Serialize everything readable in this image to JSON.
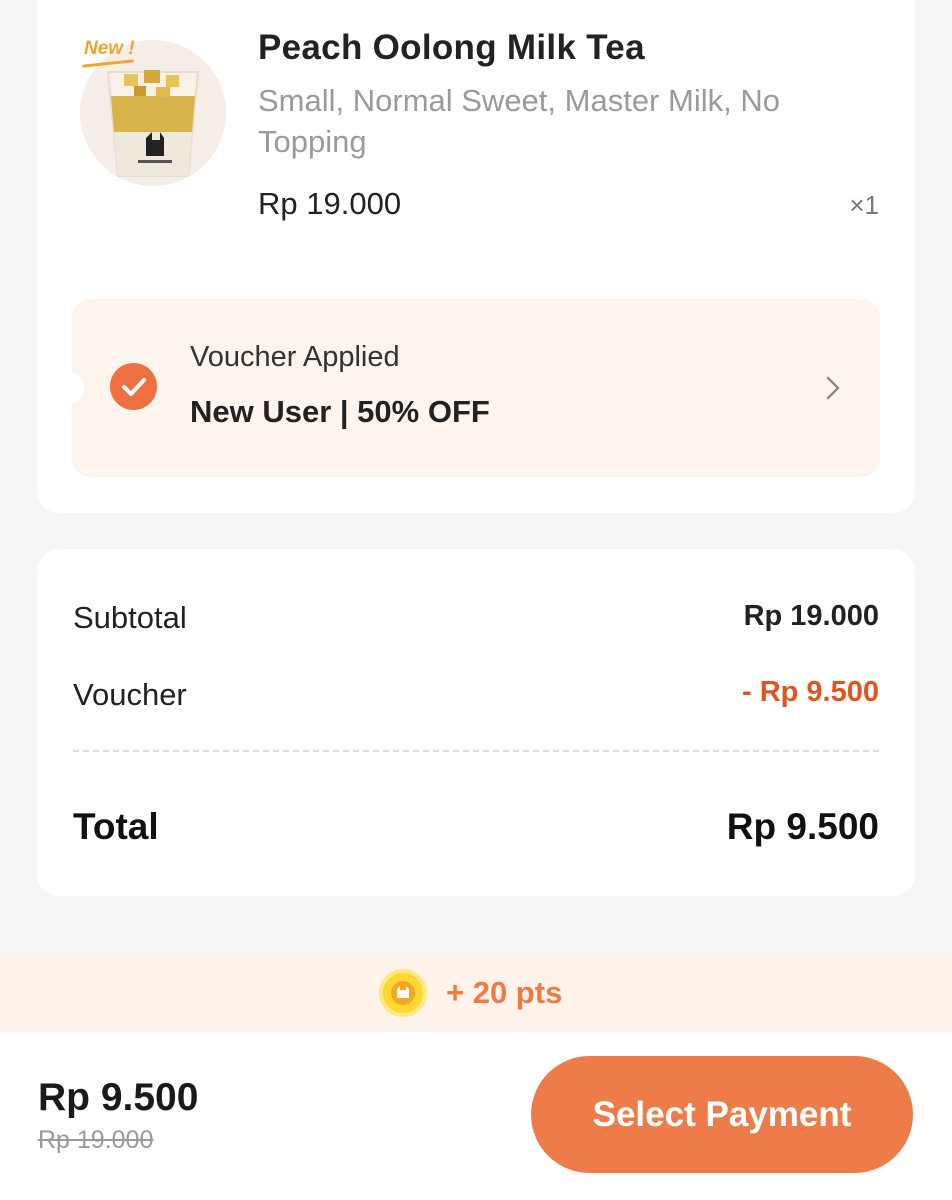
{
  "item": {
    "new_tag": "New !",
    "name": "Peach Oolong Milk Tea",
    "options": "Small, Normal Sweet, Master Milk, No Topping",
    "price": "Rp 19.000",
    "quantity": "×1"
  },
  "voucher": {
    "label": "Voucher Applied",
    "name": "New User | 50% OFF"
  },
  "summary": {
    "subtotal_label": "Subtotal",
    "subtotal_value": "Rp 19.000",
    "voucher_label": "Voucher",
    "voucher_value": "- Rp 9.500",
    "total_label": "Total",
    "total_value": "Rp 9.500"
  },
  "points": {
    "text": "+ 20 pts"
  },
  "checkout": {
    "final_price": "Rp 9.500",
    "original_price": "Rp 19.000",
    "button_label": "Select Payment"
  },
  "colors": {
    "accent": "#ee7c4a",
    "discount": "#e0541f",
    "voucher_bg": "#fdf4ee",
    "points_bg": "#fdf3ea",
    "coin": "#fdd835"
  },
  "icons": {
    "check": "check-icon",
    "chevron": "chevron-right-icon",
    "coin": "coin-icon"
  }
}
